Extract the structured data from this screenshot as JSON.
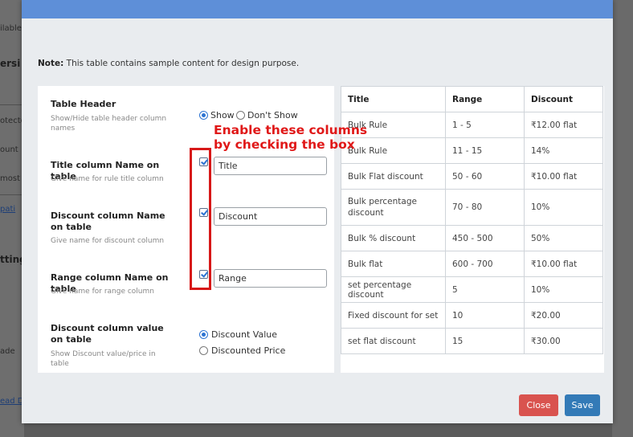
{
  "background": {
    "fragments": [
      "ilable",
      "ersi",
      "otecte",
      "ount",
      "most r",
      "pati",
      "tting",
      "ade",
      "ead D"
    ]
  },
  "modal": {
    "note_label": "Note:",
    "note_text": " This table contains sample content for design purpose.",
    "settings": {
      "table_header": {
        "label": "Table Header",
        "help": "Show/Hide table header column names",
        "show_label": "Show",
        "dont_show_label": "Don't Show",
        "selected": "Show"
      },
      "title_column": {
        "label": "Title column Name on table",
        "help": "Give name for rule title column",
        "value": "Title",
        "checked": true
      },
      "discount_column": {
        "label": "Discount column Name on table",
        "help": "Give name for discount column",
        "value": "Discount",
        "checked": true
      },
      "range_column": {
        "label": "Range column Name on table",
        "help": "Give name for range column",
        "value": "Range",
        "checked": true
      },
      "discount_value": {
        "label": "Discount column value on table",
        "help": "Show Discount value/price in table",
        "option_value": "Discount Value",
        "option_price": "Discounted Price",
        "selected": "Discount Value"
      }
    },
    "annotation": {
      "line1": "Enable these columns",
      "line2": "by checking the box",
      "color": "#e01818"
    },
    "table": {
      "headers": [
        "Title",
        "Range",
        "Discount"
      ],
      "rows": [
        [
          "Bulk Rule",
          "1 - 5",
          "₹12.00 flat"
        ],
        [
          "Bulk Rule",
          "11 - 15",
          "14%"
        ],
        [
          "Bulk Flat discount",
          "50 - 60",
          "₹10.00 flat"
        ],
        [
          "Bulk percentage discount",
          "70 - 80",
          "10%"
        ],
        [
          "Bulk % discount",
          "450 - 500",
          "50%"
        ],
        [
          "Bulk flat",
          "600 - 700",
          "₹10.00 flat"
        ],
        [
          "set percentage discount",
          "5",
          "10%"
        ],
        [
          "Fixed discount for set",
          "10",
          "₹20.00"
        ],
        [
          "set flat discount",
          "15",
          "₹30.00"
        ]
      ]
    },
    "buttons": {
      "close": "Close",
      "save": "Save",
      "close_color": "#d9534f",
      "save_color": "#337ab7"
    }
  }
}
